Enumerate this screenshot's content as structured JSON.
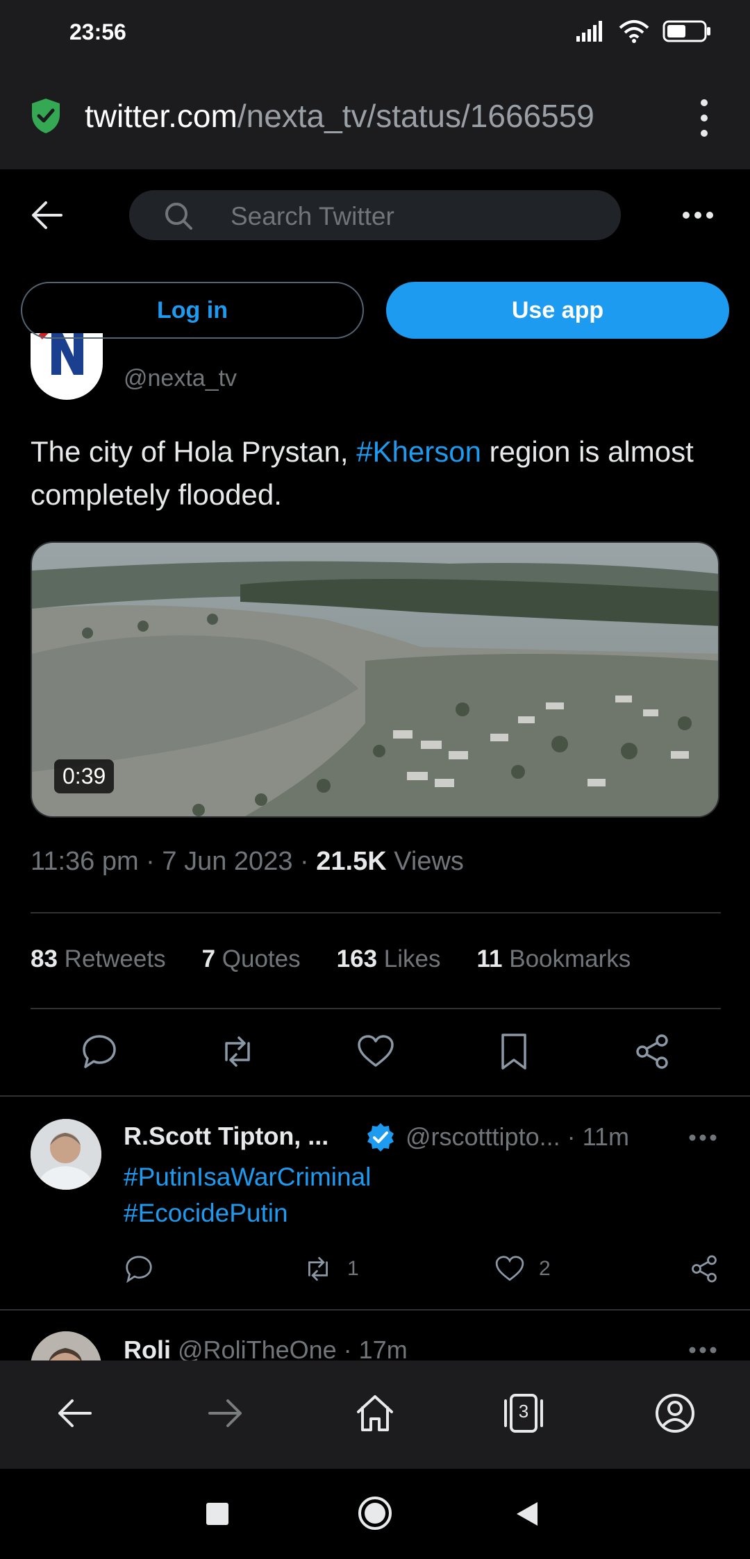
{
  "status_bar": {
    "time": "23:56"
  },
  "browser": {
    "url_host": "twitter.com",
    "url_path": "/nexta_tv/status/1666559",
    "tab_count": "3"
  },
  "header": {
    "search_placeholder": "Search Twitter"
  },
  "auth": {
    "login_label": "Log in",
    "app_label": "Use app"
  },
  "tweet": {
    "handle": "@nexta_tv",
    "text_before": "The city of Hola Prystan, ",
    "hashtag": "#Kherson",
    "text_after": " region is almost completely flooded.",
    "video_duration": "0:39",
    "time": "11:36 pm",
    "date": "7 Jun 2023",
    "views_count": "21.5K",
    "views_label": "Views",
    "stats": {
      "retweets_count": "83",
      "retweets_label": "Retweets",
      "quotes_count": "7",
      "quotes_label": "Quotes",
      "likes_count": "163",
      "likes_label": "Likes",
      "bookmarks_count": "11",
      "bookmarks_label": "Bookmarks"
    }
  },
  "reply1": {
    "name": "R.Scott Tipton, ...",
    "handle": "@rscotttipto...",
    "age": "· 11m",
    "tag1": "#PutinIsaWarCriminal",
    "tag2": "#EcocidePutin",
    "retweets": "1",
    "likes": "2"
  },
  "reply2": {
    "name": "Roli",
    "handle": "@RoliTheOne",
    "age": "· 17m"
  },
  "colors": {
    "accent": "#1d9bf0",
    "background": "#000000",
    "chrome": "#1c1c1e",
    "secure": "#34a853"
  }
}
